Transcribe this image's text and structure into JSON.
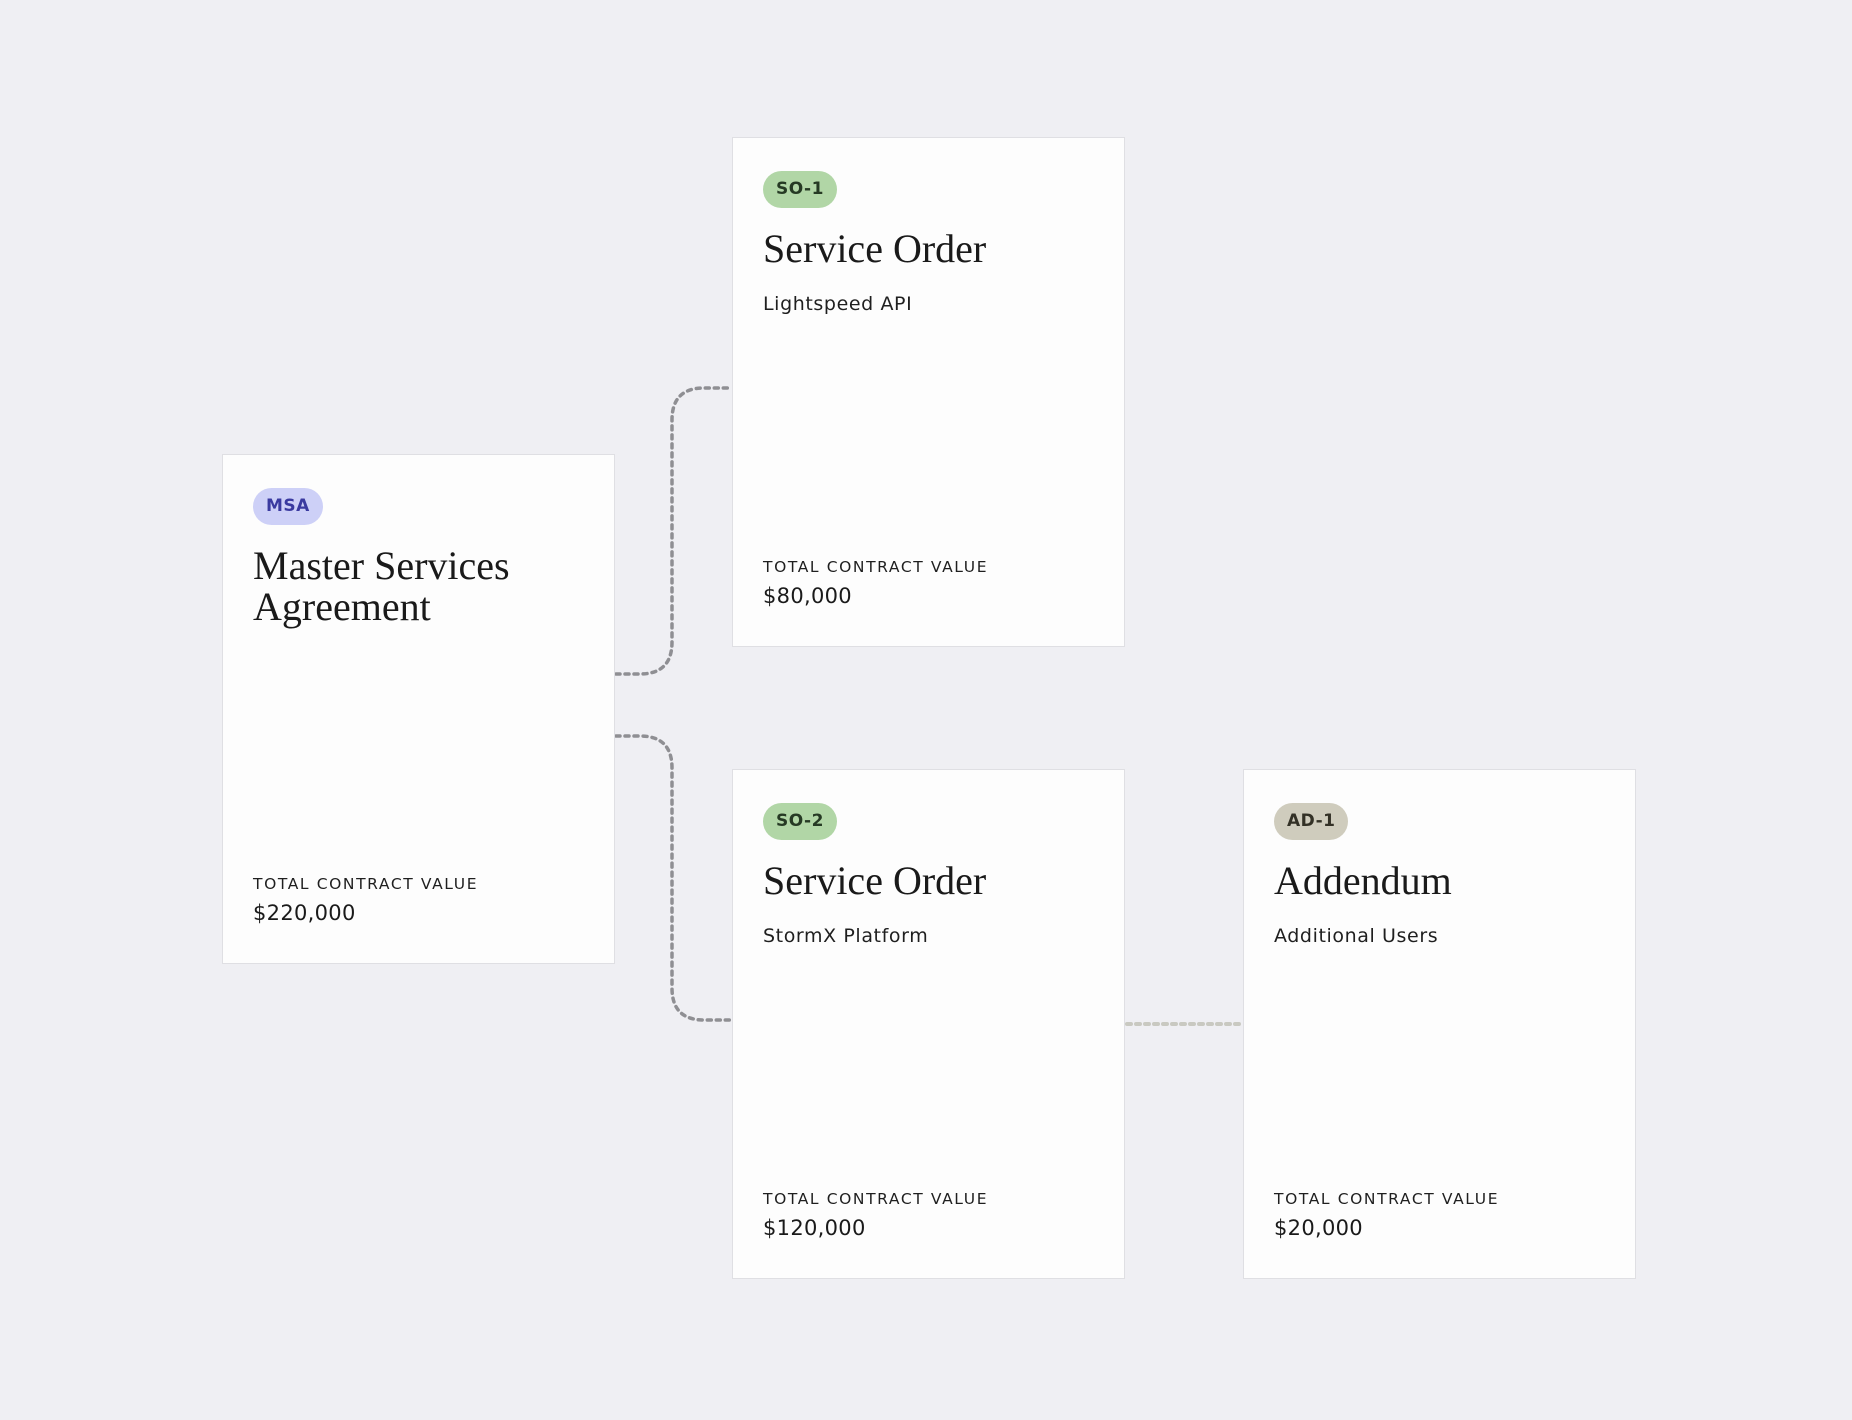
{
  "cards": {
    "msa": {
      "badge": "MSA",
      "title": "Master Services Agreement",
      "tcv_label": "TOTAL CONTRACT VALUE",
      "tcv_value": "$220,000"
    },
    "so1": {
      "badge": "SO-1",
      "title": "Service Order",
      "subtitle": "Lightspeed API",
      "tcv_label": "TOTAL CONTRACT VALUE",
      "tcv_value": "$80,000"
    },
    "so2": {
      "badge": "SO-2",
      "title": "Service Order",
      "subtitle": "StormX Platform",
      "tcv_label": "TOTAL CONTRACT VALUE",
      "tcv_value": "$120,000"
    },
    "ad1": {
      "badge": "AD-1",
      "title": "Addendum",
      "subtitle": "Additional Users",
      "tcv_label": "TOTAL CONTRACT VALUE",
      "tcv_value": "$20,000"
    }
  },
  "colors": {
    "background": "#efeff3",
    "msa_badge": "#cdd0f7",
    "service_order_badge": "#b1d6a6",
    "addendum_badge": "#cfccbd",
    "connector": "#8f8f93",
    "connector_light": "#c9c9c1"
  }
}
